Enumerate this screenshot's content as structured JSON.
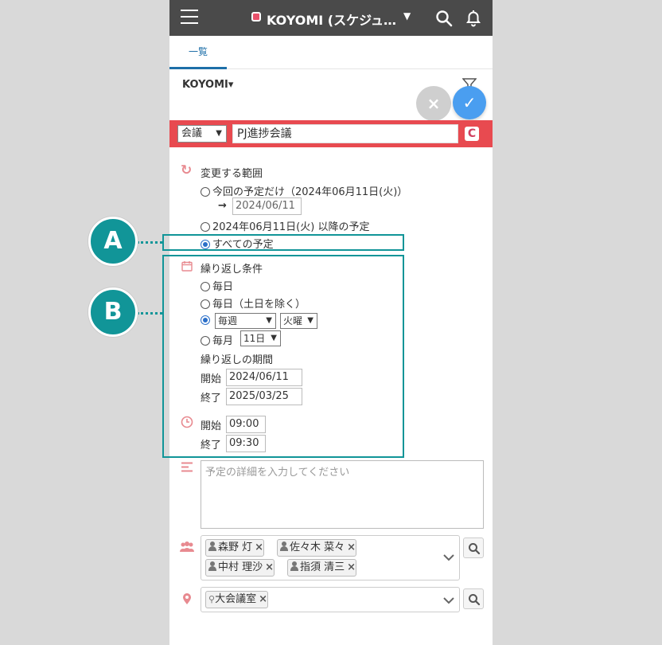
{
  "topbar": {
    "app_title": "KOYOMI (スケジュ…",
    "caret": "▼"
  },
  "tabs": [
    {
      "label": "一覧",
      "active": true
    }
  ],
  "calendar_selector": "KOYOMI▾",
  "actions": {
    "cancel": "×",
    "ok": "✓"
  },
  "event": {
    "type": "会議",
    "subject": "PJ進捗会議",
    "refresh_glyph": "C"
  },
  "scope": {
    "heading": "変更する範囲",
    "options": [
      {
        "label": "今回の予定だけ（2024年06月11日(火)）",
        "selected": false
      },
      {
        "label": "2024年06月11日(火) 以降の予定",
        "selected": false
      },
      {
        "label": "すべての予定",
        "selected": true
      }
    ],
    "arrow": "→",
    "move_date": "2024/06/11"
  },
  "repeat": {
    "heading": "繰り返し条件",
    "daily": "毎日",
    "weekdays": "毎日（土日を除く）",
    "weekly_value": "毎週",
    "weekday_value": "火曜",
    "monthly": "毎月",
    "monthly_day": "11日",
    "period_heading": "繰り返しの期間",
    "start_label": "開始",
    "start_date": "2024/06/11",
    "end_label": "終了",
    "end_date": "2025/03/25"
  },
  "time": {
    "start_label": "開始",
    "start": "09:00",
    "end_label": "終了",
    "end": "09:30"
  },
  "details_placeholder": "予定の詳細を入力してください",
  "participants": [
    "森野 灯",
    "佐々木 菜々",
    "中村 理沙",
    "指須 清三"
  ],
  "facilities": [
    "大会議室"
  ],
  "chip_remove": "×",
  "callouts": {
    "a": "A",
    "b": "B"
  },
  "colors": {
    "topbar": "#4a4a4a",
    "title_bar": "#e84a50",
    "accent": "#1e6fa8",
    "ok": "#4a9ef0",
    "callout": "#119598"
  }
}
